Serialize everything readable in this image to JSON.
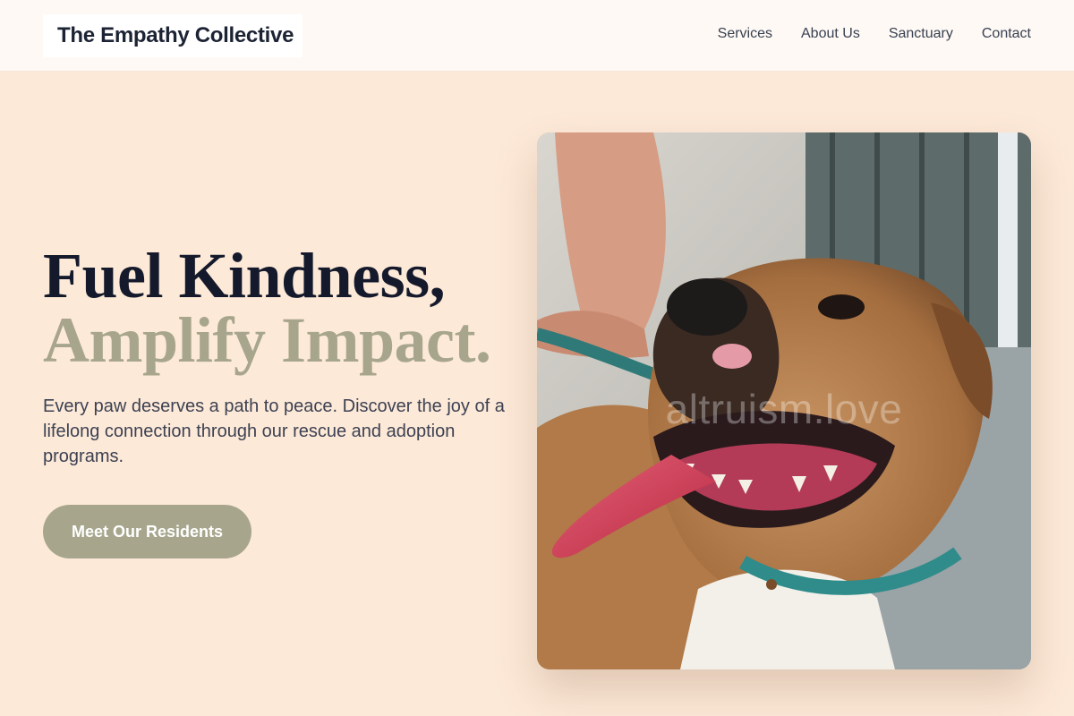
{
  "header": {
    "brand": "The Empathy Collective",
    "nav": [
      "Services",
      "About Us",
      "Sanctuary",
      "Contact"
    ]
  },
  "hero": {
    "headline_line1": "Fuel Kindness,",
    "headline_line2": "Amplify Impact.",
    "subtitle": "Every paw deserves a path to peace. Discover the joy of a lifelong connection through our rescue and adoption programs.",
    "cta_label": "Meet Our Residents"
  },
  "photo": {
    "subject": "dog-photo",
    "watermark": "altruism.love"
  },
  "colors": {
    "page_bg": "#fde9d8",
    "header_bg": "#fff9f5",
    "accent_sage": "#a7a68d",
    "heading_dark": "#141a2b",
    "body_text": "#3c4152"
  }
}
